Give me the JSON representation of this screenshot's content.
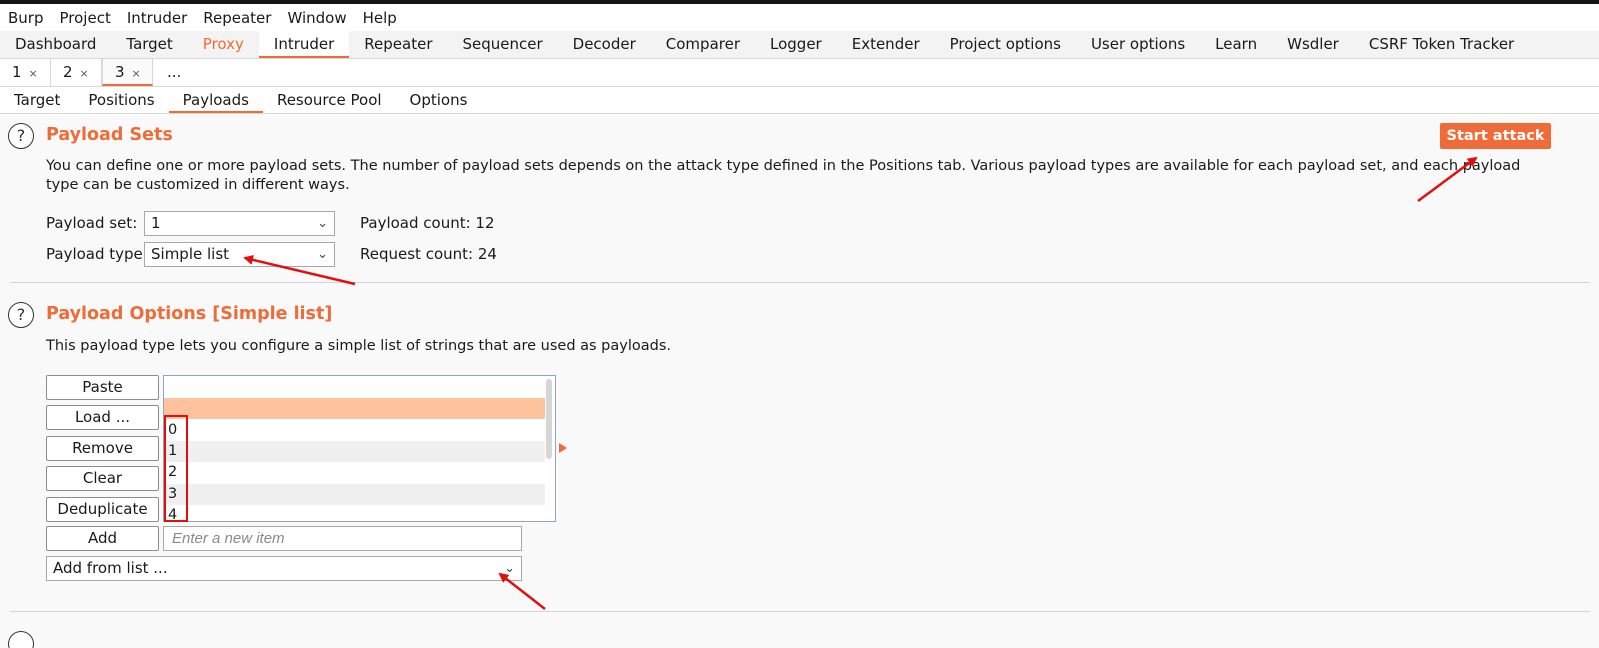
{
  "menu": [
    "Burp",
    "Project",
    "Intruder",
    "Repeater",
    "Window",
    "Help"
  ],
  "main_tabs": [
    "Dashboard",
    "Target",
    "Proxy",
    "Intruder",
    "Repeater",
    "Sequencer",
    "Decoder",
    "Comparer",
    "Logger",
    "Extender",
    "Project options",
    "User options",
    "Learn",
    "Wsdler",
    "CSRF Token Tracker"
  ],
  "main_tab_active": "Intruder",
  "instance_tabs": [
    {
      "label": "1",
      "close": "×"
    },
    {
      "label": "2",
      "close": "×"
    },
    {
      "label": "3",
      "close": "×"
    }
  ],
  "instance_more": "...",
  "sub_tabs": [
    "Target",
    "Positions",
    "Payloads",
    "Resource Pool",
    "Options"
  ],
  "sub_tab_active": "Payloads",
  "payload_sets": {
    "help_glyph": "?",
    "title": "Payload Sets",
    "start_attack": "Start attack",
    "description": "You can define one or more payload sets. The number of payload sets depends on the attack type defined in the Positions tab. Various payload types are available for each payload set, and each payload type can be customized in different ways.",
    "set_label": "Payload set:",
    "set_value": "1",
    "type_label": "Payload type:",
    "type_value": "Simple list",
    "payload_count": "Payload count: 12",
    "request_count": "Request count: 24"
  },
  "payload_options": {
    "help_glyph": "?",
    "title": "Payload Options [Simple list]",
    "description": "This payload type lets you configure a simple list of strings that are used as payloads.",
    "buttons": [
      "Paste",
      "Load ...",
      "Remove",
      "Clear",
      "Deduplicate"
    ],
    "list_items": [
      "",
      "",
      "0",
      "1",
      "2",
      "3",
      "4"
    ],
    "add_button": "Add",
    "add_placeholder": "Enter a new item",
    "add_from_list": "Add from list ..."
  },
  "icons": {
    "chevron": "chevron-down-icon",
    "help": "help-icon"
  },
  "colors": {
    "accent": "#ef6b37",
    "selected_row": "#ffc29e",
    "annotation": "#e30f0f"
  }
}
